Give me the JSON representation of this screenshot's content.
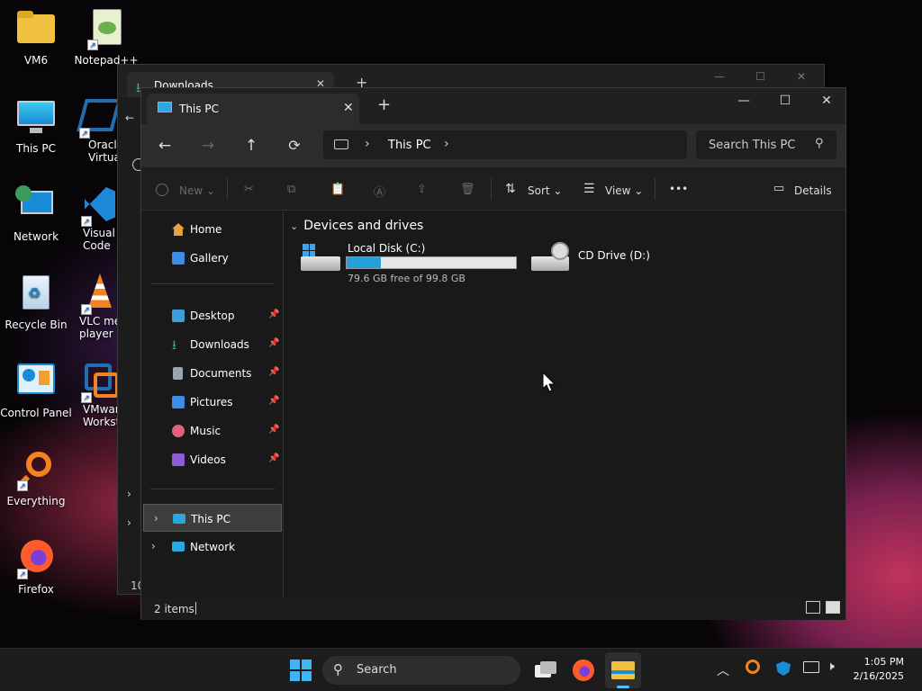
{
  "desktop": {
    "icons": [
      {
        "label": "VM6"
      },
      {
        "label": "Notepad++"
      },
      {
        "label": "This PC"
      },
      {
        "label": "Oracle VirtualB"
      },
      {
        "label": "Network"
      },
      {
        "label": "Visual Stu Code"
      },
      {
        "label": "Recycle Bin"
      },
      {
        "label": "VLC me player"
      },
      {
        "label": "Control Panel"
      },
      {
        "label": "VMwar Workst"
      },
      {
        "label": "Everything"
      },
      {
        "label": "Firefox"
      }
    ]
  },
  "back_window": {
    "tab_title": "Downloads",
    "status_partial": "10"
  },
  "window": {
    "tab_title": "This PC",
    "tab_close": "✕",
    "new_tab": "+",
    "controls": {
      "minimize": "—",
      "maximize": "☐",
      "close": "✕"
    },
    "nav": {
      "back": "←",
      "forward": "→",
      "up": "↑",
      "refresh": "⟳"
    },
    "address": {
      "separator": "›",
      "crumb": "This PC",
      "trailing": "›"
    },
    "search_placeholder": "Search This PC",
    "toolbar": {
      "new_label": "New",
      "sort_label": "Sort",
      "view_label": "View",
      "more_label": "•••",
      "details_label": "Details"
    },
    "sidebar": {
      "top": [
        {
          "label": "Home",
          "icon": "home-icon",
          "color": "#e8a33d"
        },
        {
          "label": "Gallery",
          "icon": "gallery-icon",
          "color": "#3b8ee8"
        }
      ],
      "pinned": [
        {
          "label": "Desktop",
          "icon": "desktop-folder-icon",
          "color": "#3b9fd8"
        },
        {
          "label": "Downloads",
          "icon": "downloads-icon",
          "color": "#2eb872"
        },
        {
          "label": "Documents",
          "icon": "documents-icon",
          "color": "#9aa5b1"
        },
        {
          "label": "Pictures",
          "icon": "pictures-icon",
          "color": "#3b8ee8"
        },
        {
          "label": "Music",
          "icon": "music-icon",
          "color": "#e0607e"
        },
        {
          "label": "Videos",
          "icon": "videos-icon",
          "color": "#8e5bd8"
        }
      ],
      "tree": [
        {
          "label": "This PC",
          "icon": "this-pc-icon",
          "selected": true
        },
        {
          "label": "Network",
          "icon": "network-icon",
          "selected": false
        }
      ]
    },
    "content": {
      "group_title": "Devices and drives",
      "drives": [
        {
          "name": "Local Disk (C:)",
          "space": "79.6 GB free of 99.8 GB",
          "used_fraction": 0.2
        },
        {
          "name": "CD Drive (D:)"
        }
      ]
    },
    "status_text": "2 items"
  },
  "taskbar": {
    "search_placeholder": "Search",
    "time": "1:05 PM",
    "date": "2/16/2025"
  },
  "colors": {
    "accent": "#1a8bd6",
    "selected_bg": "#3d3d3d"
  }
}
